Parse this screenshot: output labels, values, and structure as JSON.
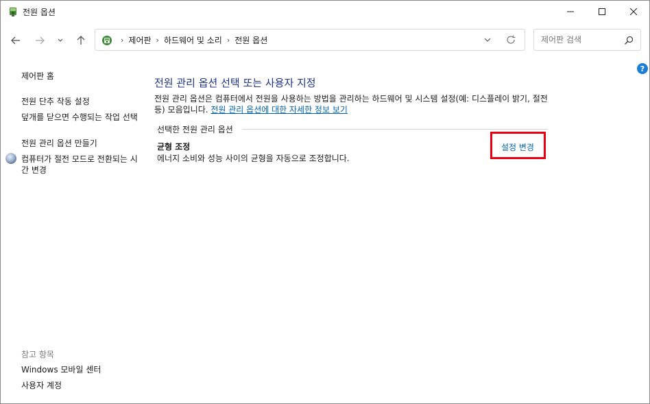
{
  "window": {
    "title": "전원 옵션"
  },
  "nav": {
    "breadcrumbs": [
      "제어판",
      "하드웨어 및 소리",
      "전원 옵션"
    ],
    "search_placeholder": "제어판 검색"
  },
  "sidebar": {
    "home_link": "제어판 홈",
    "links": [
      "전원 단추 작동 설정",
      "덮개를 닫으면 수행되는 작업 선택",
      "전원 관리 옵션 만들기",
      "컴퓨터가 절전 모드로 전환되는 시간 변경"
    ],
    "see_also_label": "참고 항목",
    "see_also_links": [
      "Windows 모바일 센터",
      "사용자 계정"
    ]
  },
  "main": {
    "title": "전원 관리 옵션 선택 또는 사용자 지정",
    "description": "전원 관리 옵션은 컴퓨터에서 전원을 사용하는 방법을 관리하는 하드웨어 및 시스템 설정(예: 디스플레이 밝기, 절전 등) 모음입니다. ",
    "description_link": "전원 관리 옵션에 대한 자세한 정보 보기",
    "selected_plans_label": "선택한 전원 관리 옵션",
    "plan": {
      "name": "균형 조정",
      "description": "에너지 소비와 성능 사이의 균형을 자동으로 조정합니다.",
      "change_link": "설정 변경"
    }
  },
  "colors": {
    "title_blue": "#1e3287",
    "link_blue": "#0063b1",
    "highlight_red": "#e60012",
    "help_blue": "#1c7fd6"
  }
}
